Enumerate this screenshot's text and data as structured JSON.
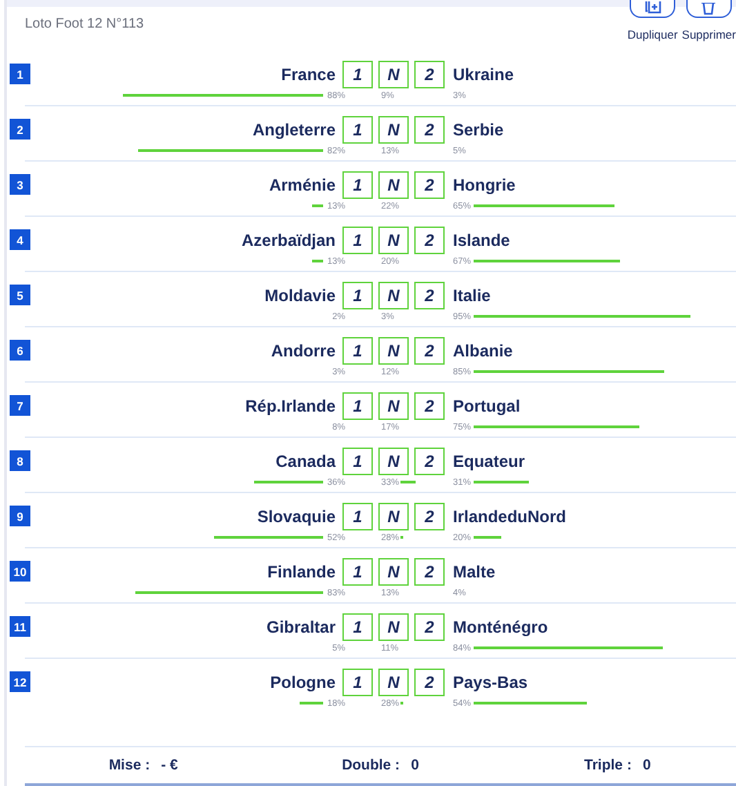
{
  "header": {
    "title": "Loto Foot 12 N°113",
    "actions": [
      {
        "label": "Dupliquer",
        "kind": "duplicate"
      },
      {
        "label": "Supprimer",
        "kind": "delete"
      }
    ]
  },
  "matches": [
    {
      "number": "1",
      "home": "France",
      "away": "Ukraine",
      "picks": [
        {
          "label": "1",
          "selected": false,
          "pct": "88%"
        },
        {
          "label": "N",
          "selected": false,
          "pct": "9%"
        },
        {
          "label": "2",
          "selected": false,
          "pct": "3%"
        }
      ]
    },
    {
      "number": "2",
      "home": "Angleterre",
      "away": "Serbie",
      "picks": [
        {
          "label": "1",
          "selected": false,
          "pct": "82%"
        },
        {
          "label": "N",
          "selected": false,
          "pct": "13%"
        },
        {
          "label": "2",
          "selected": false,
          "pct": "5%"
        }
      ]
    },
    {
      "number": "3",
      "home": "Arménie",
      "away": "Hongrie",
      "picks": [
        {
          "label": "1",
          "selected": false,
          "pct": "13%"
        },
        {
          "label": "N",
          "selected": false,
          "pct": "22%"
        },
        {
          "label": "2",
          "selected": false,
          "pct": "65%"
        }
      ]
    },
    {
      "number": "4",
      "home": "Azerbaïdjan",
      "away": "Islande",
      "picks": [
        {
          "label": "1",
          "selected": false,
          "pct": "13%"
        },
        {
          "label": "N",
          "selected": false,
          "pct": "20%"
        },
        {
          "label": "2",
          "selected": false,
          "pct": "67%"
        }
      ]
    },
    {
      "number": "5",
      "home": "Moldavie",
      "away": "Italie",
      "picks": [
        {
          "label": "1",
          "selected": false,
          "pct": "2%"
        },
        {
          "label": "N",
          "selected": false,
          "pct": "3%"
        },
        {
          "label": "2",
          "selected": false,
          "pct": "95%"
        }
      ]
    },
    {
      "number": "6",
      "home": "Andorre",
      "away": "Albanie",
      "picks": [
        {
          "label": "1",
          "selected": false,
          "pct": "3%"
        },
        {
          "label": "N",
          "selected": false,
          "pct": "12%"
        },
        {
          "label": "2",
          "selected": false,
          "pct": "85%"
        }
      ]
    },
    {
      "number": "7",
      "home": "Rép.Irlande",
      "away": "Portugal",
      "picks": [
        {
          "label": "1",
          "selected": false,
          "pct": "8%"
        },
        {
          "label": "N",
          "selected": false,
          "pct": "17%"
        },
        {
          "label": "2",
          "selected": false,
          "pct": "75%"
        }
      ]
    },
    {
      "number": "8",
      "home": "Canada",
      "away": "Equateur",
      "picks": [
        {
          "label": "1",
          "selected": false,
          "pct": "36%"
        },
        {
          "label": "N",
          "selected": false,
          "pct": "33%"
        },
        {
          "label": "2",
          "selected": false,
          "pct": "31%"
        }
      ]
    },
    {
      "number": "9",
      "home": "Slovaquie",
      "away": "IrlandeduNord",
      "picks": [
        {
          "label": "1",
          "selected": false,
          "pct": "52%"
        },
        {
          "label": "N",
          "selected": false,
          "pct": "28%"
        },
        {
          "label": "2",
          "selected": false,
          "pct": "20%"
        }
      ]
    },
    {
      "number": "10",
      "home": "Finlande",
      "away": "Malte",
      "picks": [
        {
          "label": "1",
          "selected": false,
          "pct": "83%"
        },
        {
          "label": "N",
          "selected": false,
          "pct": "13%"
        },
        {
          "label": "2",
          "selected": false,
          "pct": "4%"
        }
      ]
    },
    {
      "number": "11",
      "home": "Gibraltar",
      "away": "Monténégro",
      "picks": [
        {
          "label": "1",
          "selected": false,
          "pct": "5%"
        },
        {
          "label": "N",
          "selected": false,
          "pct": "11%"
        },
        {
          "label": "2",
          "selected": false,
          "pct": "84%"
        }
      ]
    },
    {
      "number": "12",
      "home": "Pologne",
      "away": "Pays-Bas",
      "picks": [
        {
          "label": "1",
          "selected": false,
          "pct": "18%"
        },
        {
          "label": "N",
          "selected": false,
          "pct": "28%"
        },
        {
          "label": "2",
          "selected": false,
          "pct": "54%"
        }
      ]
    }
  ],
  "footer": [
    {
      "label": "Mise :",
      "value": "- €"
    },
    {
      "label": "Double :",
      "value": "0"
    },
    {
      "label": "Triple :",
      "value": "0"
    }
  ]
}
